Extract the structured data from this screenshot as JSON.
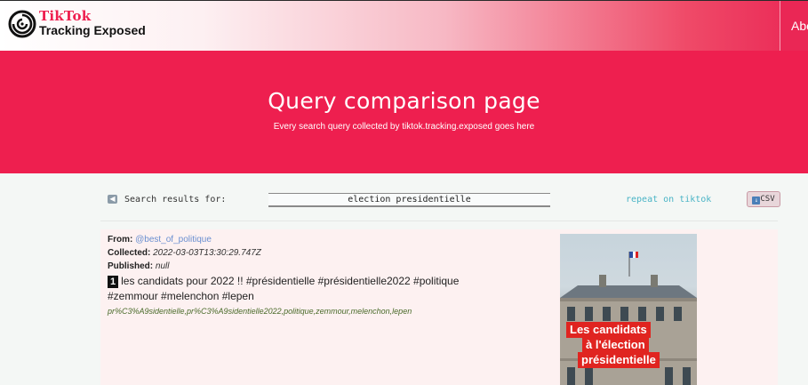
{
  "brand": {
    "title": "TikTok",
    "subtitle": "Tracking Exposed"
  },
  "nav": {
    "about_label": "About"
  },
  "hero": {
    "title": "Query comparison page",
    "subtitle": "Every search query collected by tiktok.tracking.exposed goes here"
  },
  "search": {
    "label": "Search results for:",
    "query": "election presidentielle",
    "repeat_label": "repeat on tiktok",
    "csv_label": "CSV"
  },
  "result": {
    "from_label": "From:",
    "from_value": "@best_of_politique",
    "collected_label": "Collected:",
    "collected_value": "2022-03-03T13:30:29.747Z",
    "published_label": "Published:",
    "published_value": "null",
    "rank": "1",
    "description": "les candidats pour 2022 !! #présidentielle #présidentielle2022 #politique #zemmour #melenchon #lepen",
    "tags": "pr%C3%A9sidentielle,pr%C3%A9sidentielle2022,politique,zemmour,melenchon,lepen",
    "thumbnail_caption": [
      "Les candidats",
      "à l'élection",
      "présidentielle"
    ]
  },
  "colors": {
    "brand_red": "#ee1f4f",
    "link_teal": "#4ab4c6",
    "tag_green": "#4a6b2a",
    "caption_red": "#e02420"
  },
  "icons": {
    "logo": "concentric-swirl-icon",
    "back": "back-arrow-icon",
    "download": "download-icon"
  }
}
